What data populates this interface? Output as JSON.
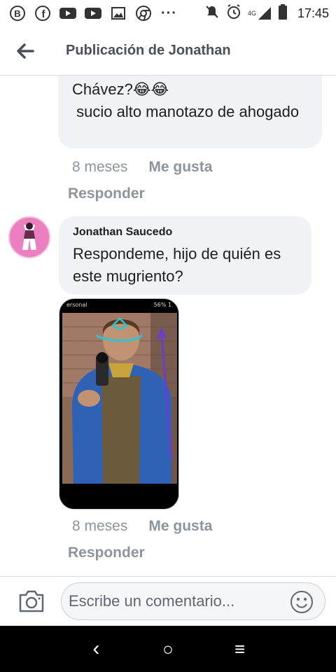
{
  "status_bar": {
    "network_label": "4G",
    "time": "17:45",
    "icons": [
      "b-circle-icon",
      "facebook-icon",
      "youtube-icon",
      "youtube-icon",
      "image-icon",
      "chrome-icon",
      "more-dots-icon",
      "mute-icon",
      "alarm-icon",
      "signal-icon",
      "battery-icon"
    ]
  },
  "header": {
    "title": "Publicación de Jonathan",
    "back_icon": "arrow-left-icon"
  },
  "comments": [
    {
      "text": "Chávez?😂😂\n sucio alto manotazo de ahogado",
      "time": "8 meses",
      "like_label": "Me gusta",
      "reply_label": "Responder"
    },
    {
      "author": "Jonathan Saucedo",
      "text": "Respondeme, hijo de quién es este mugriento?",
      "photo_status_left": "ersonal ",
      "photo_status_right": "56% 1",
      "time": "8 meses",
      "like_label": "Me gusta",
      "reply_label": "Responder"
    }
  ],
  "composer": {
    "placeholder": "Escribe un comentario...",
    "camera_icon": "camera-icon",
    "emoji_icon": "smiley-icon"
  },
  "nav": {
    "back": "‹",
    "home": "○",
    "recents": "≡"
  },
  "colors": {
    "bubble": "#f0f2f5",
    "meta_text": "#8d949e",
    "header_text": "#4b4f56"
  }
}
